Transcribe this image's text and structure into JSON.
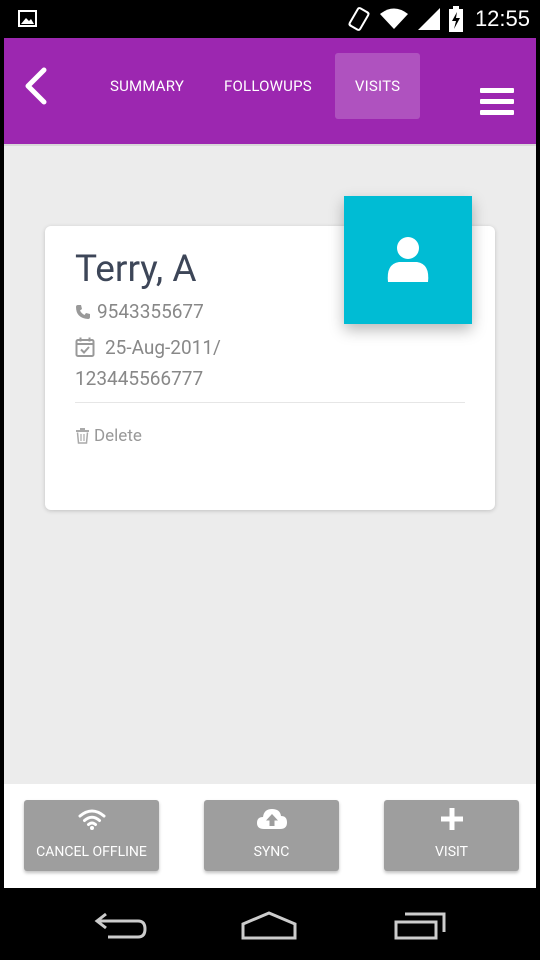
{
  "status_bar": {
    "time": "12:55",
    "icons": [
      "gallery-icon",
      "vibrate-icon",
      "wifi-icon",
      "signal-icon",
      "battery-charging-icon"
    ]
  },
  "header": {
    "back_icon": "chevron-left-icon",
    "tabs": [
      {
        "label": "SUMMARY",
        "active": false
      },
      {
        "label": "FOLLOWUPS",
        "active": false
      },
      {
        "label": "VISITS",
        "active": true
      }
    ],
    "menu_icon": "hamburger-menu-icon",
    "color": "#9c27b0"
  },
  "patient": {
    "name": "Terry, A",
    "phone": "9543355677",
    "dob_id_line1": "25-Aug-2011/",
    "dob_id_line2": "123445566777",
    "delete_label": "Delete",
    "avatar_color": "#00bcd4"
  },
  "actions": {
    "cancel_offline": {
      "label": "CANCEL OFFLINE",
      "icon": "wifi-icon"
    },
    "sync": {
      "label": "SYNC",
      "icon": "cloud-upload-icon"
    },
    "visit": {
      "label": "VISIT",
      "icon": "plus-icon"
    },
    "button_color": "#9e9e9e"
  },
  "nav": {
    "icons": [
      "back-nav-icon",
      "home-nav-icon",
      "recent-apps-icon"
    ]
  }
}
